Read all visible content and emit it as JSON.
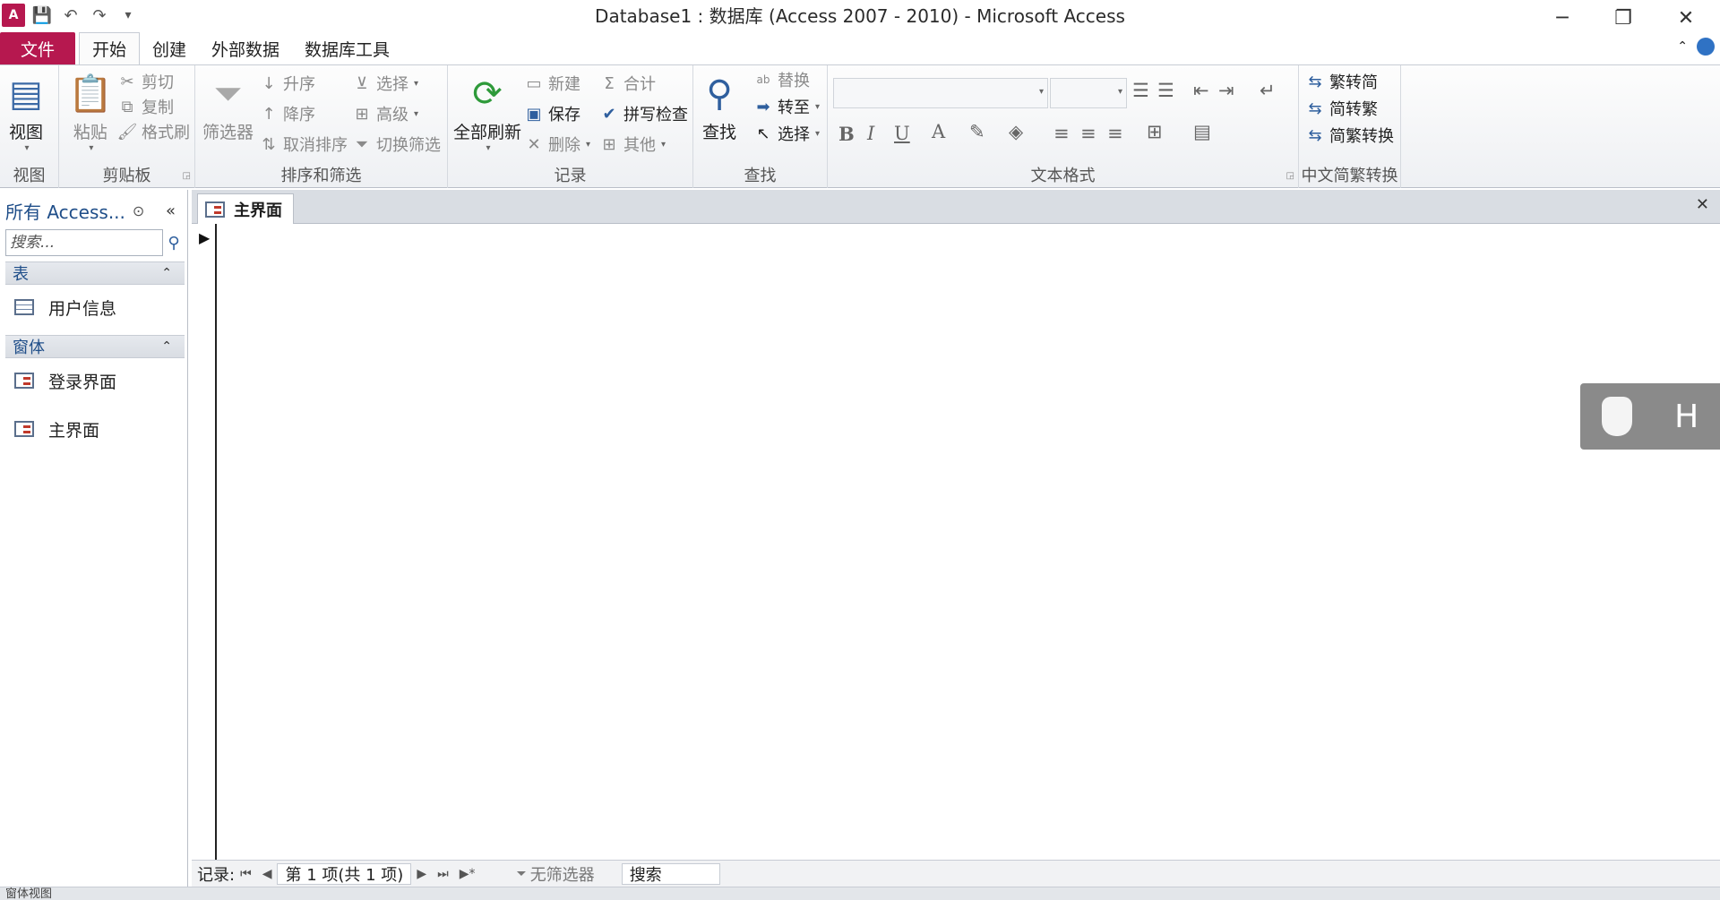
{
  "window": {
    "title": "Database1 : 数据库 (Access 2007 - 2010)  -  Microsoft Access",
    "app_icon": "access-app-icon",
    "minimize": "─",
    "restore": "❐",
    "close": "✕"
  },
  "qat": {
    "customize": "▾"
  },
  "tabs": [
    {
      "label": "文件",
      "type": "file"
    },
    {
      "label": "开始",
      "active": true
    },
    {
      "label": "创建"
    },
    {
      "label": "外部数据"
    },
    {
      "label": "数据库工具"
    }
  ],
  "ribbon": {
    "groups": {
      "view": "视图",
      "clipboard": "剪贴板",
      "sort_filter": "排序和筛选",
      "records": "记录",
      "find": "查找",
      "text_format": "文本格式",
      "chinese": "中文简繁转换"
    },
    "buttons": {
      "view": "视图",
      "paste": "粘贴",
      "cut": "剪切",
      "copy": "复制",
      "format_painter": "格式刷",
      "filter": "筛选器",
      "ascending": "升序",
      "descending": "降序",
      "remove_sort": "取消排序",
      "selection": "选择",
      "advanced": "高级",
      "toggle_filter": "切换筛选",
      "refresh_all": "全部刷新",
      "new": "新建",
      "save": "保存",
      "delete": "删除",
      "totals": "合计",
      "spelling": "拼写检查",
      "more": "其他",
      "find": "查找",
      "replace": "替换",
      "goto": "转至",
      "select": "选择",
      "to_simplified": "繁转简",
      "to_traditional": "简转繁",
      "convert": "简繁转换"
    },
    "format_glyphs": {
      "bold": "B",
      "italic": "I",
      "underline": "U",
      "font_color": "A"
    }
  },
  "nav": {
    "header": "所有 Access...",
    "search_placeholder": "搜索...",
    "sections": [
      {
        "label": "表",
        "items": [
          "用户信息"
        ]
      },
      {
        "label": "窗体",
        "items": [
          "登录界面",
          "主界面"
        ]
      }
    ]
  },
  "document": {
    "tab_label": "主界面",
    "close": "✕"
  },
  "floating_widget": {
    "letter": "H"
  },
  "record_nav": {
    "label": "记录:",
    "position": "第 1 项(共 1 项)",
    "filter": "无筛选器",
    "search": "搜索"
  },
  "status": {
    "text": "窗体视图"
  }
}
